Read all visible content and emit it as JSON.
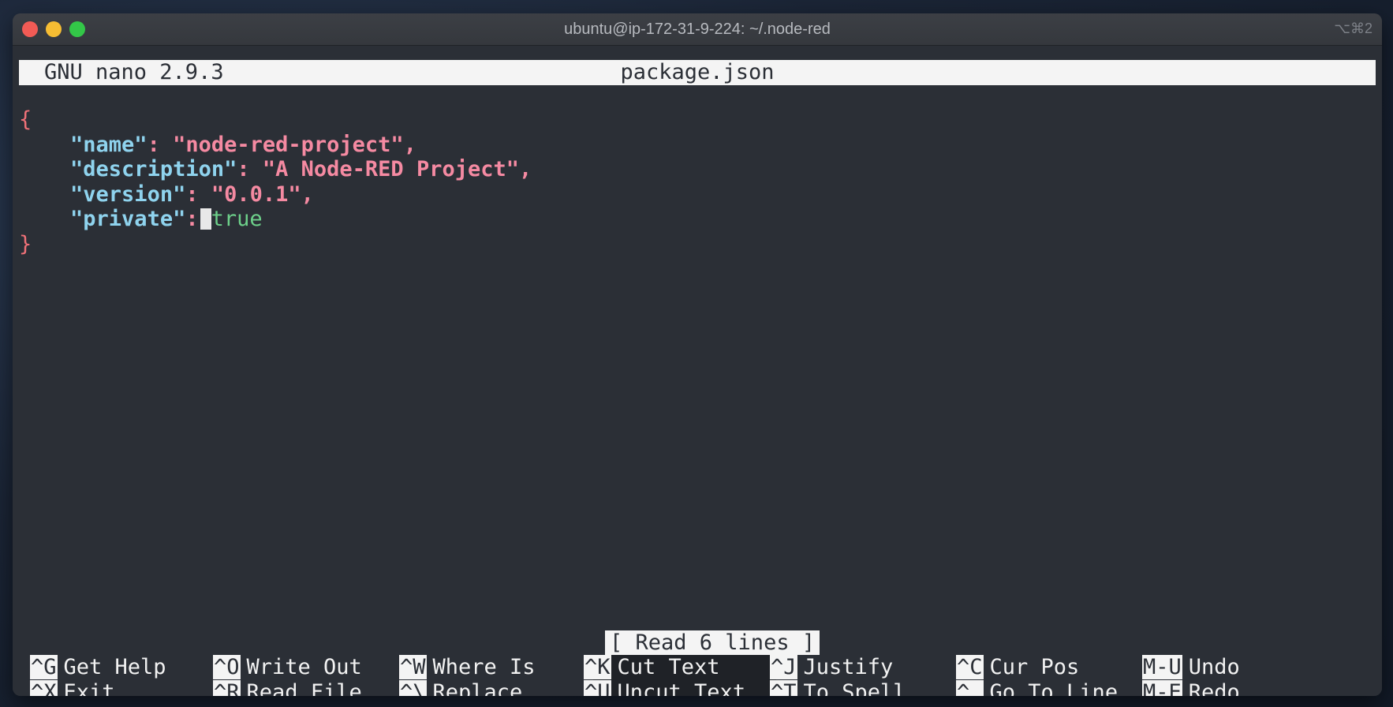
{
  "window": {
    "title": "ubuntu@ip-172-31-9-224: ~/.node-red",
    "shortcut": "⌥⌘2"
  },
  "nano": {
    "version": "GNU nano 2.9.3",
    "filename": "package.json",
    "status": "[ Read 6 lines ]"
  },
  "file": {
    "open_brace": "{",
    "close_brace": "}",
    "entries": [
      {
        "key": "\"name\"",
        "value": "\"node-red-project\"",
        "trail": ","
      },
      {
        "key": "\"description\"",
        "value": "\"A Node-RED Project\"",
        "trail": ","
      },
      {
        "key": "\"version\"",
        "value": "\"0.0.1\"",
        "trail": ","
      },
      {
        "key": "\"private\"",
        "value": "true",
        "trail": ""
      }
    ]
  },
  "shortcuts": {
    "row0": [
      {
        "key": "^G",
        "label": "Get Help"
      },
      {
        "key": "^O",
        "label": "Write Out"
      },
      {
        "key": "^W",
        "label": "Where Is"
      },
      {
        "key": "^K",
        "label": "Cut Text"
      },
      {
        "key": "^J",
        "label": "Justify"
      },
      {
        "key": "^C",
        "label": "Cur Pos"
      },
      {
        "key": "M-U",
        "label": "Undo"
      }
    ],
    "row1": [
      {
        "key": "^X",
        "label": "Exit"
      },
      {
        "key": "^R",
        "label": "Read File"
      },
      {
        "key": "^\\",
        "label": "Replace"
      },
      {
        "key": "^U",
        "label": "Uncut Text"
      },
      {
        "key": "^T",
        "label": "To Spell"
      },
      {
        "key": "^_",
        "label": "Go To Line"
      },
      {
        "key": "M-E",
        "label": "Redo"
      }
    ]
  }
}
